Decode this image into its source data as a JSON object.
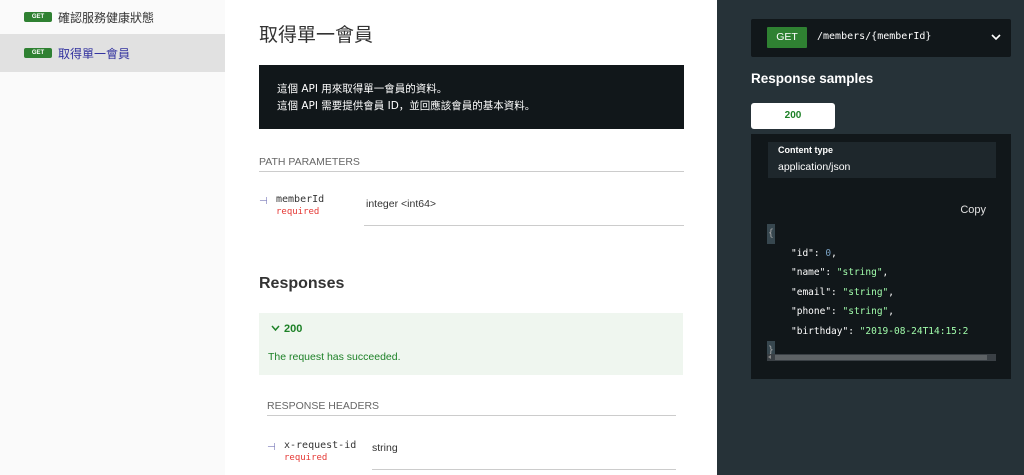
{
  "sidebar": {
    "items": [
      {
        "method": "GET",
        "label": "確認服務健康狀態"
      },
      {
        "method": "GET",
        "label": "取得單一會員"
      }
    ]
  },
  "operation": {
    "title": "取得單一會員",
    "description_lines": [
      "這個 API 用來取得單一會員的資料。",
      "這個 API 需要提供會員 ID，並回應該會員的基本資料。"
    ]
  },
  "path_parameters": {
    "title": "PATH PARAMETERS",
    "params": [
      {
        "name": "memberId",
        "required": "required",
        "type": "integer <int64>"
      }
    ]
  },
  "responses": {
    "title": "Responses",
    "items": [
      {
        "code": "200",
        "description": "The request has succeeded."
      }
    ],
    "headers_title": "RESPONSE HEADERS",
    "headers": [
      {
        "name": "x-request-id",
        "required": "required",
        "type": "string"
      }
    ]
  },
  "right_panel": {
    "endpoint": {
      "method": "GET",
      "path": "/members/{memberId}"
    },
    "samples_title": "Response samples",
    "status_tab": "200",
    "content_type_label": "Content type",
    "content_type_value": "application/json",
    "copy_label": "Copy",
    "json": {
      "open": "{",
      "close": "}",
      "lines": [
        {
          "key": "\"id\"",
          "value": "0",
          "kind": "num",
          "comma": ","
        },
        {
          "key": "\"name\"",
          "value": "\"string\"",
          "kind": "str",
          "comma": ","
        },
        {
          "key": "\"email\"",
          "value": "\"string\"",
          "kind": "str",
          "comma": ","
        },
        {
          "key": "\"phone\"",
          "value": "\"string\"",
          "kind": "str",
          "comma": ","
        },
        {
          "key": "\"birthday\"",
          "value": "\"2019-08-24T14:15:2",
          "kind": "str",
          "comma": ""
        }
      ]
    }
  },
  "colors": {
    "get_green": "#2f8132",
    "success_green": "#1d8127",
    "right_panel_bg": "#263238",
    "code_bg": "#11171a",
    "required_red": "#e53935"
  }
}
